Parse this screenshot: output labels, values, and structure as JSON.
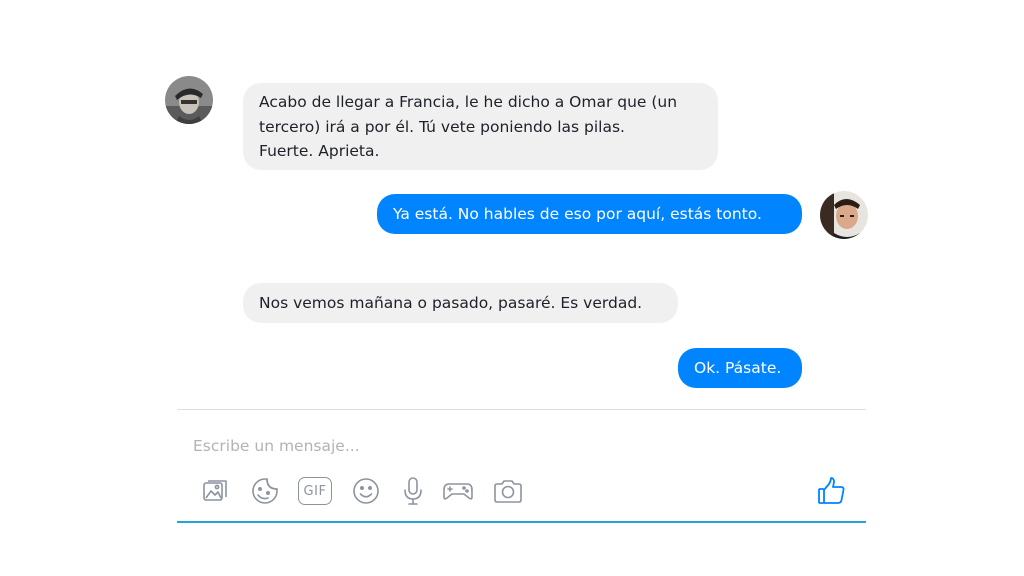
{
  "messages": [
    {
      "direction": "incoming",
      "lines": [
        "Acabo de llegar a Francia, le he dicho a Omar que (un",
        "tercero) irá a por él. Tú vete poniendo las pilas.",
        "Fuerte. Aprieta."
      ]
    },
    {
      "direction": "outgoing",
      "text": "Ya está. No hables de eso por aquí, estás tonto."
    },
    {
      "direction": "incoming",
      "text": "Nos vemos mañana o pasado, pasaré. Es verdad."
    },
    {
      "direction": "outgoing",
      "text": "Ok. Pásate."
    }
  ],
  "composer": {
    "placeholder": "Escribe un mensaje...",
    "gif_label": "GIF",
    "icons": [
      "image-icon",
      "sticker-icon",
      "gif-icon",
      "emoji-icon",
      "microphone-icon",
      "game-controller-icon",
      "camera-icon",
      "thumbs-up-icon"
    ]
  },
  "colors": {
    "outgoing_bubble": "#0084ff",
    "incoming_bubble": "#f1f0f0",
    "accent_line": "#21a3dd",
    "icon_gray": "#8d949e"
  }
}
